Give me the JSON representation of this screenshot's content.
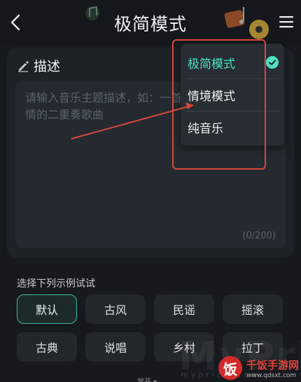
{
  "header": {
    "title": "极简模式"
  },
  "description": {
    "label": "描述",
    "placeholder": "请输入音乐主题描述，如：一首柔情的二重奏歌曲",
    "counter": "(0/200)"
  },
  "mode_menu": {
    "items": [
      {
        "label": "极简模式",
        "selected": true
      },
      {
        "label": "情境模式",
        "selected": false
      },
      {
        "label": "纯音乐",
        "selected": false
      }
    ]
  },
  "examples": {
    "label": "选择下列示例试试",
    "chips": [
      "默认",
      "古风",
      "民谣",
      "摇滚",
      "古典",
      "说唱",
      "乡村",
      "拉丁"
    ],
    "selected": "默认",
    "expand_label": "展开"
  },
  "watermark": {
    "text": "MyPrice",
    "small": "myprice.com"
  },
  "site_logo": {
    "badge": "饭",
    "name": "千饭手游网",
    "url": "www.qdsxt.com"
  },
  "colors": {
    "accent": "#4fe0c4",
    "annotation_red": "#d9483a",
    "background": "#16191d"
  }
}
